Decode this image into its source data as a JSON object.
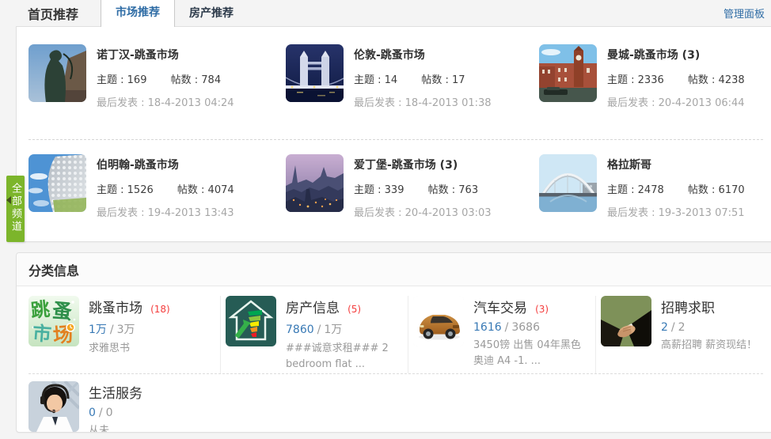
{
  "colors": {
    "accent_blue": "#2e6ca5",
    "number_blue": "#3879b5",
    "count_red": "#f43d3d",
    "side_tab_green": "#7cb52b",
    "page_bg": "#f4f4f4"
  },
  "recommend": {
    "title": "首页推荐",
    "tabs": [
      {
        "label": "市场推荐",
        "active": true
      },
      {
        "label": "房产推荐",
        "active": false
      }
    ],
    "admin_link": "管理面板",
    "labels": {
      "topics": "主题 :",
      "posts": "帖数 :",
      "last_post": "最后发表 :"
    },
    "forums": [
      {
        "name": "诺丁汉-跳蚤市场",
        "topics": "169",
        "posts": "784",
        "last_post": "18-4-2013 04:24",
        "thumb": "nottingham-statue-photo"
      },
      {
        "name": "伦敦-跳蚤市场",
        "topics": "14",
        "posts": "17",
        "last_post": "18-4-2013 01:38",
        "thumb": "london-tower-bridge-photo"
      },
      {
        "name": "曼城-跳蚤市场 (3)",
        "topics": "2336",
        "posts": "4238",
        "last_post": "20-4-2013 06:44",
        "thumb": "manchester-canal-photo"
      },
      {
        "name": "伯明翰-跳蚤市场",
        "topics": "1526",
        "posts": "4074",
        "last_post": "19-4-2013 13:43",
        "thumb": "birmingham-selfridges-photo"
      },
      {
        "name": "爱丁堡-跳蚤市场 (3)",
        "topics": "339",
        "posts": "763",
        "last_post": "20-4-2013 03:03",
        "thumb": "edinburgh-skyline-photo"
      },
      {
        "name": "格拉斯哥",
        "topics": "2478",
        "posts": "6170",
        "last_post": "19-3-2013 07:51",
        "thumb": "glasgow-arc-bridge-photo"
      }
    ]
  },
  "side_tab": {
    "label": "全部频道"
  },
  "classified": {
    "title": "分类信息",
    "separator": "/",
    "categories": [
      {
        "name": "跳蚤市场",
        "count": "(18)",
        "threads": "1万",
        "posts": "3万",
        "latest": "求雅思书",
        "icon": "flea-market-icon"
      },
      {
        "name": "房产信息",
        "count": "(5)",
        "threads": "7860",
        "posts": "1万",
        "latest": "###诚意求租### 2 bedroom flat ...",
        "icon": "property-epc-icon"
      },
      {
        "name": "汽车交易",
        "count": "(3)",
        "threads": "1616",
        "posts": "3686",
        "latest": "3450镑 出售 04年黑色奥迪 A4 -1. ...",
        "icon": "car-icon"
      },
      {
        "name": "招聘求职",
        "count": "",
        "threads": "2",
        "posts": "2",
        "latest": "高薪招聘 薪资现结！",
        "icon": "handshake-icon"
      },
      {
        "name": "生活服务",
        "count": "",
        "threads": "0",
        "posts": "0",
        "latest": "从未",
        "icon": "customer-service-icon"
      }
    ]
  }
}
